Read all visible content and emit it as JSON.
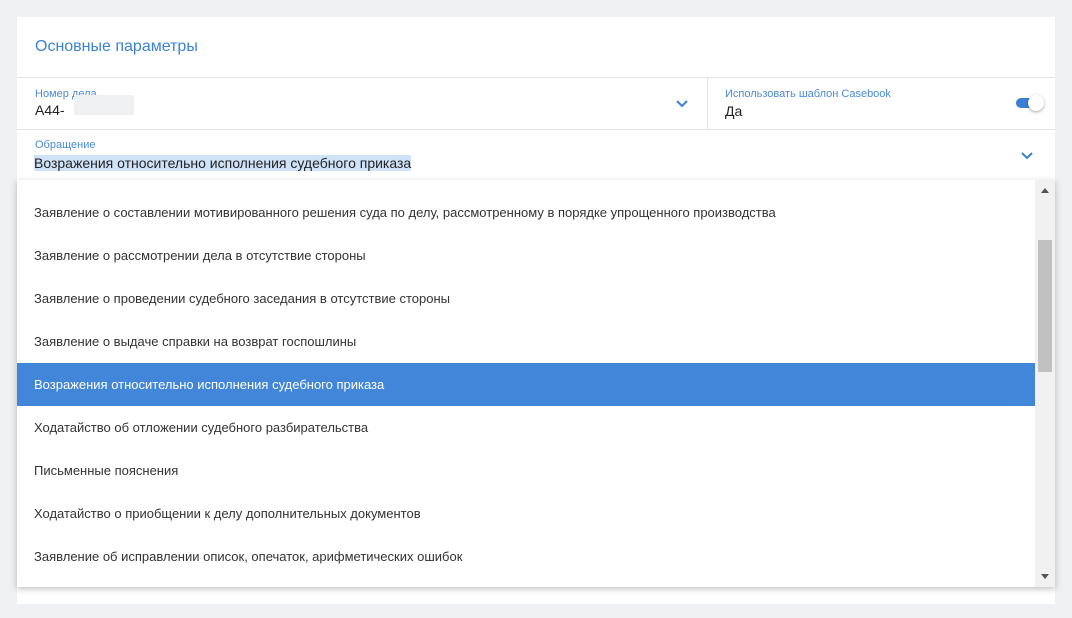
{
  "section": {
    "title": "Основные параметры"
  },
  "case_number": {
    "label": "Номер дела",
    "value": "А44-"
  },
  "casebook_template": {
    "label": "Использовать шаблон Casebook",
    "value": "Да",
    "enabled": true
  },
  "appeal": {
    "label": "Обращение",
    "value": "Возражения относительно исполнения судебного приказа"
  },
  "dropdown": {
    "options": [
      "Заявление о составлении мотивированного решения суда по делу, рассмотренному в порядке упрощенного производства",
      "Заявление о рассмотрении дела в отсутствие стороны",
      "Заявление о проведении судебного заседания в отсутствие стороны",
      "Заявление о выдаче справки на возврат госпошлины",
      "Возражения относительно исполнения судебного приказа",
      "Ходатайство об отложении судебного разбирательства",
      "Письменные пояснения",
      "Ходатайство о приобщении к делу дополнительных документов",
      "Заявление об исправлении описок, опечаток, арифметических ошибок"
    ],
    "selected_index": 4
  },
  "colors": {
    "accent": "#3b82d6",
    "selected_bg": "#4286da",
    "toggle": "#3b7fd4"
  },
  "icons": [
    "chevron-down-icon",
    "toggle-switch",
    "scroll-up-arrow-icon",
    "scroll-down-arrow-icon"
  ]
}
